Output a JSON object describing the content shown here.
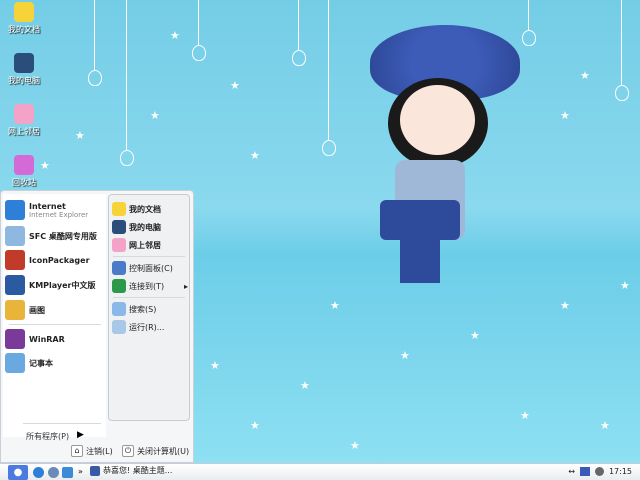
{
  "desktop": {
    "icons": [
      {
        "label": "我的文档",
        "icon": "my-documents-icon",
        "color": "#f7d33a"
      },
      {
        "label": "我的电脑",
        "icon": "my-computer-icon",
        "color": "#2a4d7a"
      },
      {
        "label": "网上邻居",
        "icon": "network-icon",
        "color": "#f4a3c8"
      },
      {
        "label": "回收站",
        "icon": "recycle-bin-icon",
        "color": "#d46ad8"
      }
    ]
  },
  "start_menu": {
    "pinned": [
      {
        "label": "Internet",
        "sub": "Internet Explorer",
        "icon": "ie-icon",
        "color": "#2d7fd8"
      },
      {
        "label": "SFC 桌酷网专用版",
        "icon": "sfc-icon",
        "color": "#8fb8e0"
      }
    ],
    "recent": [
      {
        "label": "IconPackager",
        "icon": "iconpackager-icon",
        "color": "#c23a2a"
      },
      {
        "label": "KMPlayer中文版",
        "icon": "kmplayer-icon",
        "color": "#2a5aa0"
      },
      {
        "label": "画图",
        "icon": "paint-icon",
        "color": "#e8b43a"
      },
      {
        "label": "WinRAR",
        "icon": "winrar-icon",
        "color": "#7a3a9a"
      },
      {
        "label": "记事本",
        "icon": "notepad-icon",
        "color": "#6aa8e0"
      }
    ],
    "all_programs": "所有程序(P)",
    "places": [
      {
        "label": "我的文档",
        "bold": true,
        "icon": "my-documents-icon",
        "color": "#f7d33a"
      },
      {
        "label": "我的电脑",
        "bold": true,
        "icon": "my-computer-icon",
        "color": "#2a4d7a"
      },
      {
        "label": "网上邻居",
        "bold": true,
        "icon": "network-icon",
        "color": "#f4a3c8"
      },
      {
        "label": "控制面板(C)",
        "icon": "control-panel-icon",
        "color": "#4a7ac8"
      },
      {
        "label": "连接到(T)",
        "icon": "connect-icon",
        "color": "#2a9a4a",
        "arrow": "▸"
      },
      {
        "label": "搜索(S)",
        "icon": "search-icon",
        "color": "#8ab8e8"
      },
      {
        "label": "运行(R)...",
        "icon": "run-icon",
        "color": "#a8c8e8"
      }
    ],
    "logoff": "注销(L)",
    "shutdown": "关闭计算机(U)"
  },
  "taskbar": {
    "task": "恭喜您! 桌酷主题...",
    "more": "»",
    "clock": "17:15",
    "accent": "#4b7be0"
  }
}
